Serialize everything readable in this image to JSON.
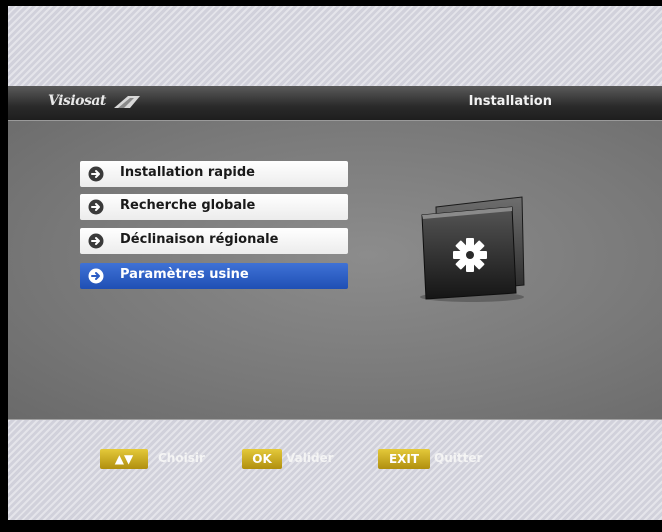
{
  "header": {
    "brand": "Visiosat",
    "title": "Installation"
  },
  "menu": {
    "items": [
      {
        "label": "Installation rapide",
        "selected": false
      },
      {
        "label": "Recherche globale",
        "selected": false
      },
      {
        "label": "Déclinaison régionale",
        "selected": false
      },
      {
        "label": "Paramètres usine",
        "selected": true
      }
    ]
  },
  "footer": {
    "hints": [
      {
        "key": "▲▼",
        "label": "Choisir"
      },
      {
        "key": "OK",
        "label": "Valider"
      },
      {
        "key": "EXIT",
        "label": "Quitter"
      }
    ]
  },
  "colors": {
    "selected_item": "#2a5cc4",
    "key_badge": "#c9a81c",
    "header_bar": "#2a2a2a"
  },
  "icons": {
    "menu_bullet": "arrow-circle-icon",
    "section": "settings-folder-icon"
  }
}
